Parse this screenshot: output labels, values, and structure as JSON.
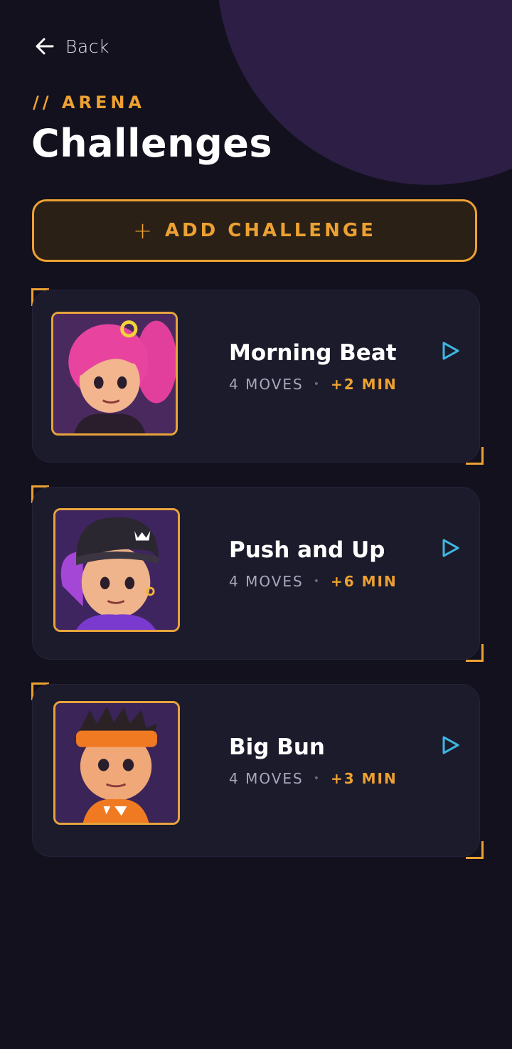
{
  "header": {
    "back_label": "Back",
    "eyebrow": "// ARENA",
    "title": "Challenges"
  },
  "add_button": {
    "icon": "plus-icon",
    "label": "ADD CHALLENGE"
  },
  "challenges": [
    {
      "title": "Morning Beat",
      "moves": "4 MOVES",
      "duration": "+2 MIN",
      "avatar": "pink-ponytail-girl-avatar"
    },
    {
      "title": "Push and Up",
      "moves": "4 MOVES",
      "duration": "+6 MIN",
      "avatar": "purple-hair-beanie-girl-avatar"
    },
    {
      "title": "Big Bun",
      "moves": "4 MOVES",
      "duration": "+3 MIN",
      "avatar": "orange-headband-boy-avatar"
    }
  ],
  "colors": {
    "background": "#12111d",
    "accent": "#eda132",
    "card": "#1c1b2b",
    "play": "#3fb6e0",
    "decor_circle": "#2c1e44"
  }
}
